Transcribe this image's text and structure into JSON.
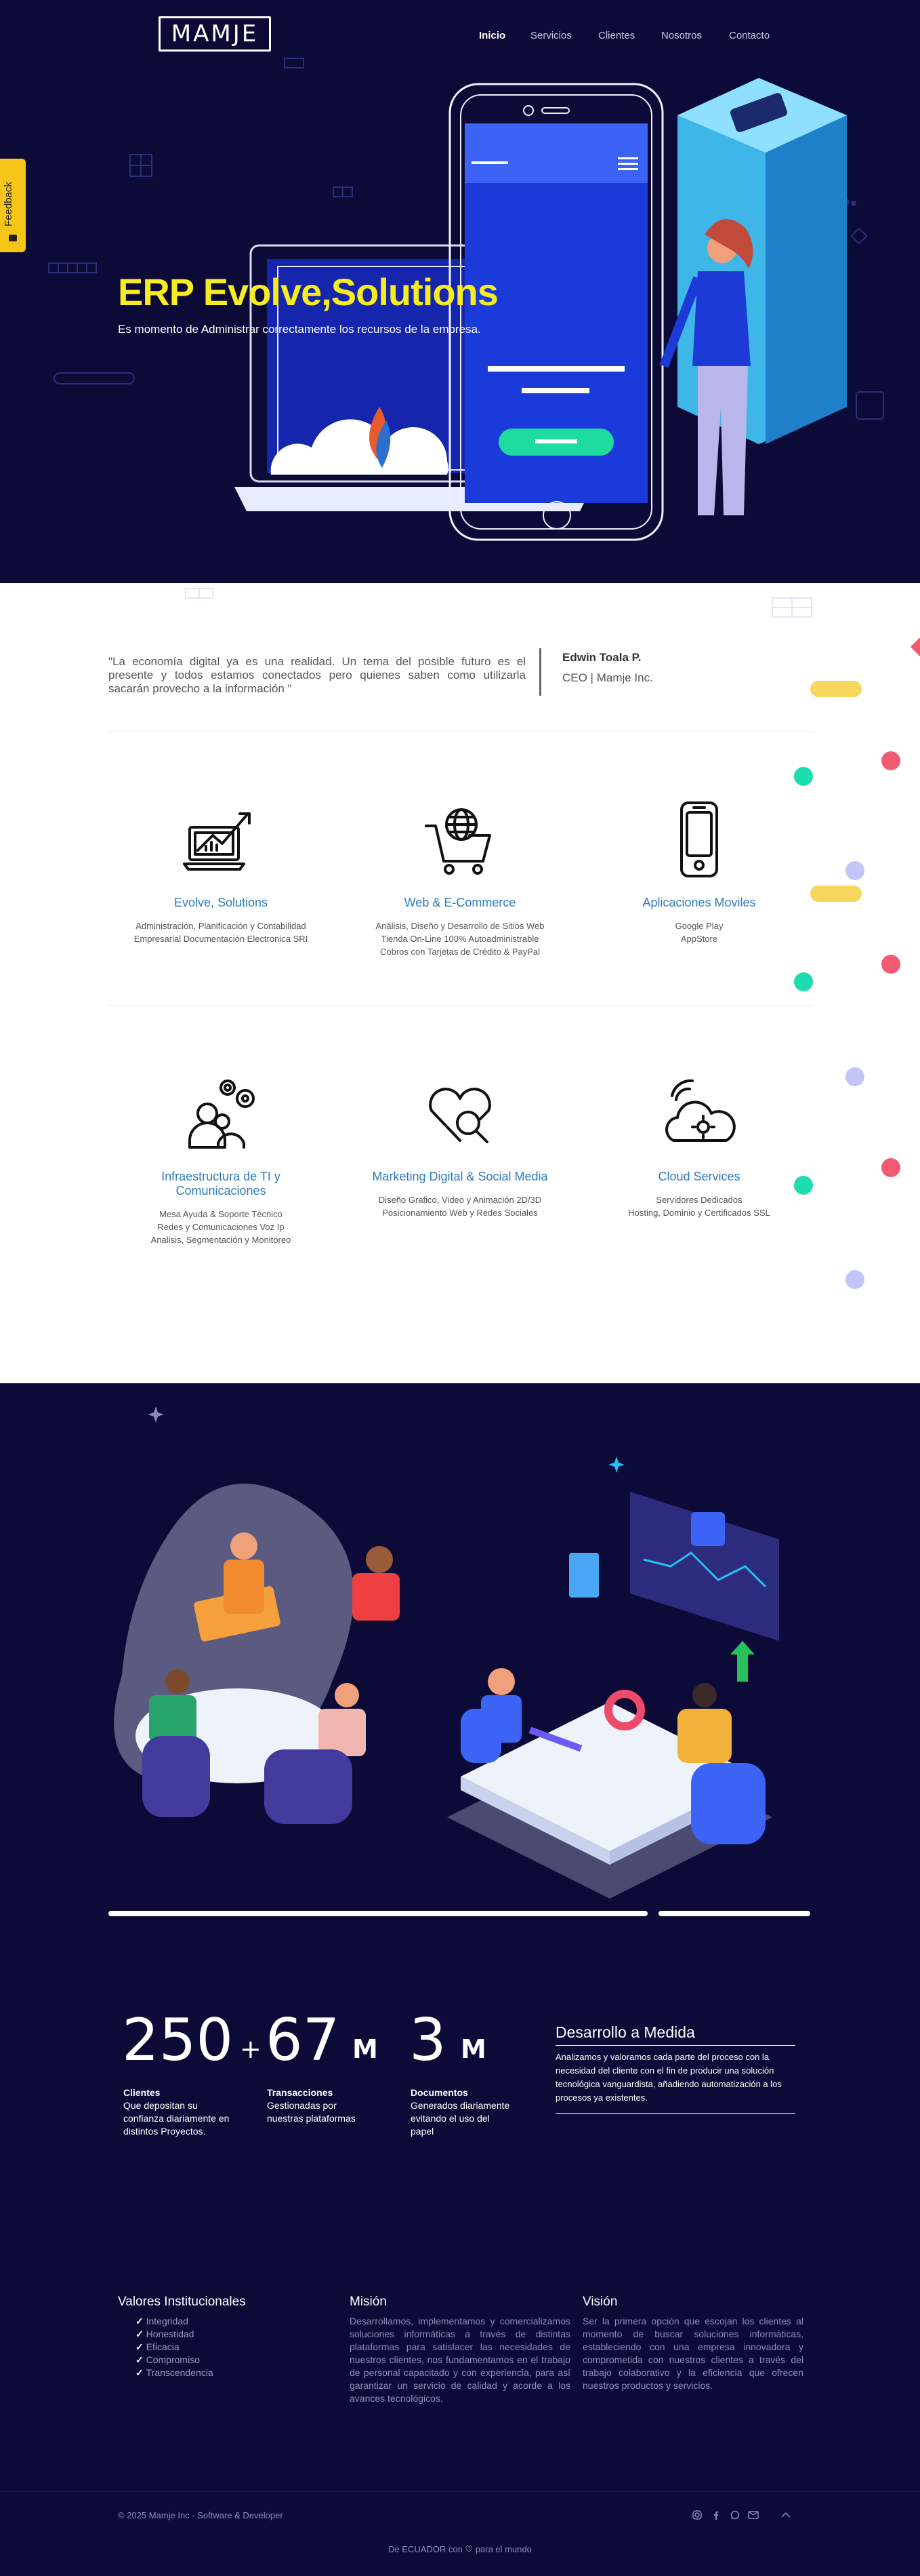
{
  "header": {
    "logo": "MAMJE",
    "nav": [
      "Inicio",
      "Servicios",
      "Clientes",
      "Nosotros",
      "Contacto"
    ],
    "active": "Inicio"
  },
  "feedback": {
    "label": "Feedback"
  },
  "hero": {
    "title": "ERP Evolve,Solutions",
    "subtitle": "Es momento de Administrar correctamente los recursos de la empresa."
  },
  "testimonial": {
    "quote": "\"La economía digital ya es una realidad. Un tema del posible futuro es el presente y todos estamos conectados pero quienes saben como utilizarla sacarán provecho a la información \"",
    "name": "Edwin Toala P.",
    "role": "CEO | Mamje Inc."
  },
  "services": [
    {
      "icon": "laptop-growth-icon",
      "title": "Evolve, Solutions",
      "lines": [
        "Administración, Planificación y Contabilidad",
        "Empresarial Documentación Electronica SRI"
      ]
    },
    {
      "icon": "cart-globe-icon",
      "title": "Web & E-Commerce",
      "lines": [
        "Análisis, Diseño y Desarrollo de Sitios Web",
        "Tienda On-Line 100% Autoadministrable",
        "Cobros con Tarjetas de Crédito & PayPal"
      ]
    },
    {
      "icon": "mobile-phone-icon",
      "title": "Aplicaciones Moviles",
      "lines": [
        "Google Play",
        "AppStore"
      ]
    },
    {
      "icon": "users-gears-icon",
      "title": "Infraestructura de TI y Comunicaciones",
      "lines": [
        "Mesa Ayuda & Soporte Técnico",
        "Redes y Comunicaciones Voz Ip",
        "Analisis, Segmentación y Monitoreo"
      ]
    },
    {
      "icon": "heart-search-icon",
      "title": "Marketing Digital & Social Media",
      "lines": [
        "Diseño Grafico, Video y Animación 2D/3D",
        "Posicionamiento Web y Redes Sociales"
      ]
    },
    {
      "icon": "cloud-services-icon",
      "title": "Cloud Services",
      "lines": [
        "Servidores Dedicados",
        "Hosting, Dominio y Certificados SSL"
      ]
    }
  ],
  "stats": [
    {
      "prefix": "",
      "value": "250",
      "unit": "",
      "title": "Clientes",
      "desc": "Que depositan su confianza diariamente en distintos Proyectos."
    },
    {
      "prefix": "+",
      "value": "67",
      "unit": "M",
      "title": "Transacciones",
      "desc": "Gestionadas por nuestras plataformas"
    },
    {
      "prefix": "",
      "value": "3",
      "unit": "M",
      "title": "Documentos",
      "desc": "Generados diariamente evitando el uso del papel"
    }
  ],
  "desarrollo": {
    "title": "Desarrollo a Medida",
    "text": "Analizamos y valoramos cada parte del proceso con la necesidad del cliente con el fin de producir una solución tecnológica vanguardista, añadiendo automatización a los procesos ya existentes."
  },
  "valores": {
    "title": "Valores Institucionales",
    "items": [
      "Integridad",
      "Honestidad",
      "Eficacia",
      "Compromiso",
      "Transcendencia"
    ]
  },
  "mision": {
    "title": "Misión",
    "text": "Desarrollamos, implementamos y comercializamos soluciones informáticas a través de distintas plataformas para satisfacer las necesidades de nuestros clientes, nos fundamentamos en el trabajo de personal capacitado y con experiencia, para así garantizar un servicio de calidad y acorde a los avances tecnológicos."
  },
  "vision": {
    "title": "Visión",
    "text": "Ser la primera opción que escojan los clientes al momento de buscar soluciones informáticas, estableciendo con una empresa innovadora y comprometida con nuestros clientes a través del trabajo colaborativo y la eficiencia que ofrecen nuestros productos y servicios."
  },
  "footer": {
    "copyright": "© 2025 Mamje Inc - Software & Developer",
    "tagline_pre": "De ECUADOR con",
    "tagline_post": "para el mundo",
    "social": [
      "instagram-icon",
      "facebook-icon",
      "whatsapp-icon",
      "email-icon"
    ]
  },
  "colors": {
    "navy": "#0c0a36",
    "accent_yellow": "#f7ec21",
    "service_blue": "#2f7bbf"
  }
}
